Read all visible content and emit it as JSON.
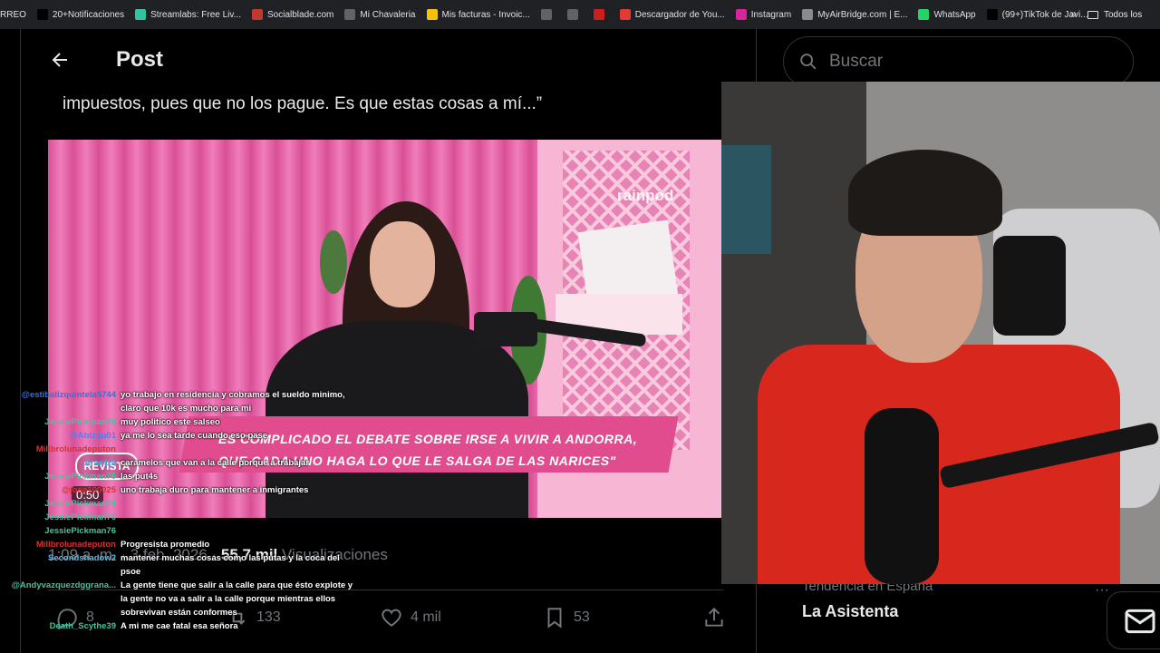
{
  "bookmarks": {
    "items": [
      {
        "label": "RREO",
        "icon": "mail-icon",
        "color": "#202124"
      },
      {
        "label": "20+Notificaciones",
        "icon": "x-logo-icon",
        "color": "#000000"
      },
      {
        "label": "Streamlabs: Free Liv...",
        "icon": "streamlabs-icon",
        "color": "#31c3a2"
      },
      {
        "label": "Socialblade.com",
        "icon": "chart-icon",
        "color": "#c0392b"
      },
      {
        "label": "Mi Chavaleria",
        "icon": "globe-icon",
        "color": "#5f6368"
      },
      {
        "label": "Mis facturas - Invoic...",
        "icon": "invoice-icon",
        "color": "#f4c20d"
      },
      {
        "label": "",
        "icon": "globe-icon",
        "color": "#5f6368"
      },
      {
        "label": "",
        "icon": "globe-icon",
        "color": "#5f6368"
      },
      {
        "label": "",
        "icon": "red-dot-icon",
        "color": "#cc1f1f"
      },
      {
        "label": "Descargador de You...",
        "icon": "download-icon",
        "color": "#e53935"
      },
      {
        "label": "Instagram",
        "icon": "instagram-icon",
        "color": "#d6249f"
      },
      {
        "label": "MyAirBridge.com | E...",
        "icon": "cloud-icon",
        "color": "#8a8a8a"
      },
      {
        "label": "WhatsApp",
        "icon": "whatsapp-icon",
        "color": "#25d366"
      },
      {
        "label": "(99+)TikTok de Javi...",
        "icon": "tiktok-icon",
        "color": "#000000"
      }
    ],
    "more": "»",
    "all": "Todos los"
  },
  "header": {
    "title": "Post"
  },
  "post": {
    "quote": "impuestos, pues que no los pague. Es que estas cosas a mí...”",
    "video": {
      "logo": "rainpod",
      "lower_third_1": "ES COMPLICADO EL DEBATE SOBRE IRSE A VIVIR A ANDORRA,",
      "lower_third_2": "QUE CADA UNO HAGA LO QUE LE SALGA DE LAS NARICES\"",
      "badge": "REVISTA",
      "time": "0:50"
    },
    "meta_time": "1:09 a. m. · 3 feb. 2026 ·",
    "meta_views_count": "55,7 mil",
    "meta_views_label": "Visualizaciones",
    "actions": {
      "replies": "8",
      "reposts": "133",
      "likes": "4 mil",
      "bookmarks": "53"
    }
  },
  "sidebar": {
    "search_placeholder": "Buscar",
    "trend_category": "Tendencia en España",
    "trend_name": "La Asistenta",
    "trend_more": "···"
  },
  "chat": [
    {
      "user": "@estibalizquintela5744",
      "msg": "yo trabajo en residencia y cobramos el sueldo minimo,",
      "color": "#3b6fd9"
    },
    {
      "user": "",
      "msg": "claro que 10k es mucho para mi",
      "color": "#ffffff"
    },
    {
      "user": "JessiePickman76",
      "msg": "muy politico este salseo",
      "color": "#43c59e"
    },
    {
      "user": "@Abizuu01",
      "msg": "ya me lo sea tarde cuando eso pase",
      "color": "#4f7ef0"
    },
    {
      "user": "Millbrolunadeputon",
      "msg": "",
      "color": "#d63131"
    },
    {
      "user": "Arantza",
      "msg": "caramelos que van a la calle porque a trabajar",
      "color": "#3fa8d8"
    },
    {
      "user": "JessiePickman76",
      "msg": "las put4s",
      "color": "#43c59e"
    },
    {
      "user": "@jose100025",
      "msg": "uno trabaja duro para mantener a inmigrantes",
      "color": "#d63131"
    },
    {
      "user": "JessiePickman76",
      "msg": "",
      "color": "#43c59e"
    },
    {
      "user": "JessiePickman76",
      "msg": "",
      "color": "#43c59e"
    },
    {
      "user": "JessiePickman76",
      "msg": "",
      "color": "#43c59e"
    },
    {
      "user": "Millbrolunadeputon",
      "msg": "Progresista promedio",
      "color": "#d63131"
    },
    {
      "user": "Secondshadow2",
      "msg": "mantener muchas cosas como las putas y la coca del",
      "color": "#5fb8e0"
    },
    {
      "user": "",
      "msg": "psoe",
      "color": "#ffffff"
    },
    {
      "user": "@Andyvazquezdggrana...",
      "msg": "La gente tiene que salir a la calle para que ésto explote y",
      "color": "#43c59e"
    },
    {
      "user": "",
      "msg": "la gente no va a salir a la calle porque mientras ellos",
      "color": "#ffffff"
    },
    {
      "user": "",
      "msg": "sobrevivan están conformes",
      "color": "#ffffff"
    },
    {
      "user": "Death_Scythe39",
      "msg": "A mi me cae fatal esa señora",
      "color": "#43c59e"
    }
  ]
}
